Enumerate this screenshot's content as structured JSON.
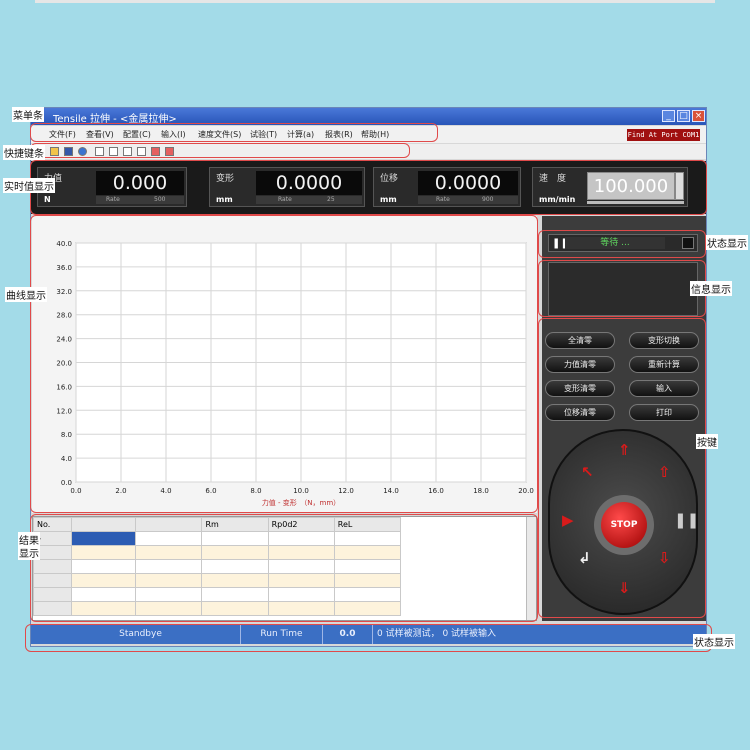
{
  "window": {
    "title": "Tensile 拉伸 - <金属拉伸>",
    "minimize": "_",
    "maximize": "□",
    "close": "×"
  },
  "menu": {
    "items": [
      "文件(F)",
      "查看(V)",
      "配置(C)",
      "输入(I)",
      "速度文件(S)",
      "试验(T)",
      "计算(a)",
      "报表(R)",
      "帮助(H)"
    ],
    "port_status": "Find At Port COM1"
  },
  "gauges": {
    "force": {
      "label": "力值",
      "unit": "N",
      "value": "0.000",
      "rate": "Rate",
      "rate_val": "500"
    },
    "deform": {
      "label": "变形",
      "unit": "mm",
      "value": "0.0000",
      "rate": "Rate",
      "rate_val": "25"
    },
    "disp": {
      "label": "位移",
      "unit": "mm",
      "value": "0.0000",
      "rate": "Rate",
      "rate_val": "900"
    },
    "speed": {
      "label": "速　度",
      "unit": "mm/min",
      "value": "100.000"
    }
  },
  "chart_data": {
    "type": "line",
    "xlabel": "力值 - 变形　（N，mm）",
    "ylabel": "",
    "xlim": [
      0,
      20
    ],
    "ylim": [
      0,
      40
    ],
    "x_ticks": [
      "0.0",
      "2.0",
      "4.0",
      "6.0",
      "8.0",
      "10.0",
      "12.0",
      "14.0",
      "16.0",
      "18.0",
      "20.0"
    ],
    "y_ticks": [
      "0.0",
      "4.0",
      "8.0",
      "12.0",
      "16.0",
      "20.0",
      "24.0",
      "28.0",
      "32.0",
      "36.0",
      "40.0"
    ],
    "series": []
  },
  "right": {
    "status_text": "等待 ...",
    "buttons": [
      "全清零",
      "变形切换",
      "力值清零",
      "重新计算",
      "变形清零",
      "输入",
      "位移清零",
      "打印"
    ],
    "stop_label": "STOP"
  },
  "results": {
    "headers": [
      "No.",
      "",
      "",
      "Rm",
      "Rp0d2",
      "ReL"
    ],
    "row_marker": "▸"
  },
  "statusbar": {
    "state": "Standbye",
    "runtime_label": "Run Time",
    "runtime_value": "0.0",
    "message": "0  试样被测试，    0  试样被输入"
  },
  "annotations": {
    "menubar": "菜单条",
    "shortcut": "快捷键条",
    "realtime": "实时值显示",
    "curve": "曲线显示",
    "result_1": "结果",
    "result_2": "显示",
    "status_r": "状态显示",
    "info": "信息显示",
    "keys": "按键",
    "status_bottom": "状态显示"
  },
  "colors": {
    "background": "#a3dbe8",
    "callout": "#e04a4a",
    "titlebar": "#2855b8",
    "statusbar": "#3b6fc4",
    "arrow_red": "#d81b1b"
  }
}
